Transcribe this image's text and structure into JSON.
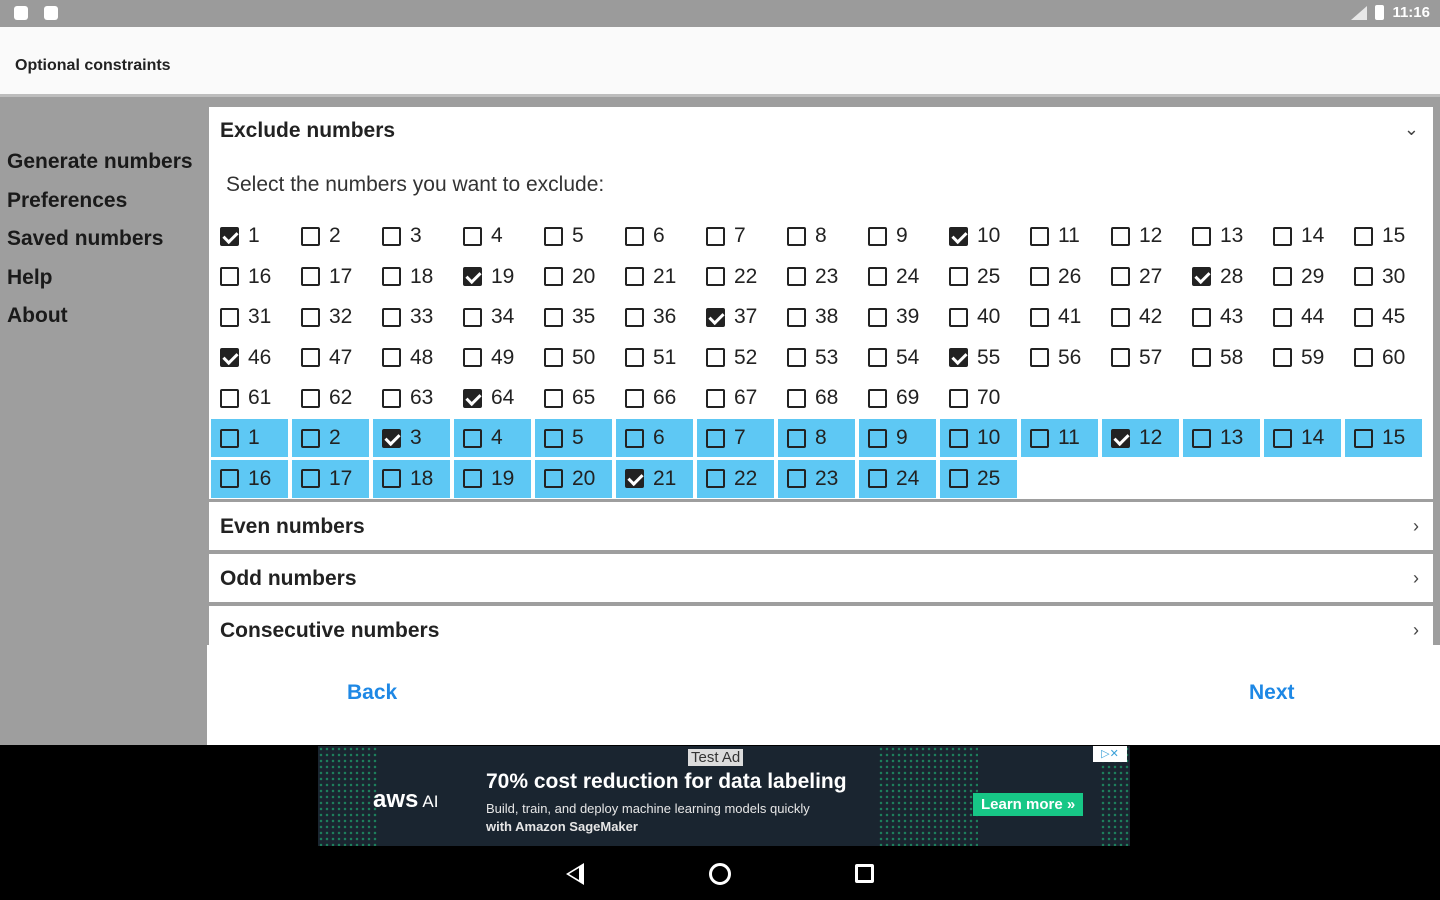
{
  "status_bar": {
    "time": "11:16"
  },
  "app_bar": {
    "title": "Optional constraints"
  },
  "sidebar": {
    "items": [
      {
        "label": "Generate numbers"
      },
      {
        "label": "Preferences"
      },
      {
        "label": "Saved numbers"
      },
      {
        "label": "Help"
      },
      {
        "label": "About"
      }
    ]
  },
  "exclude": {
    "title": "Exclude numbers",
    "description": "Select the numbers you want to exclude:",
    "main_numbers": [
      {
        "n": "1",
        "checked": true
      },
      {
        "n": "2",
        "checked": false
      },
      {
        "n": "3",
        "checked": false
      },
      {
        "n": "4",
        "checked": false
      },
      {
        "n": "5",
        "checked": false
      },
      {
        "n": "6",
        "checked": false
      },
      {
        "n": "7",
        "checked": false
      },
      {
        "n": "8",
        "checked": false
      },
      {
        "n": "9",
        "checked": false
      },
      {
        "n": "10",
        "checked": true
      },
      {
        "n": "11",
        "checked": false
      },
      {
        "n": "12",
        "checked": false
      },
      {
        "n": "13",
        "checked": false
      },
      {
        "n": "14",
        "checked": false
      },
      {
        "n": "15",
        "checked": false
      },
      {
        "n": "16",
        "checked": false
      },
      {
        "n": "17",
        "checked": false
      },
      {
        "n": "18",
        "checked": false
      },
      {
        "n": "19",
        "checked": true
      },
      {
        "n": "20",
        "checked": false
      },
      {
        "n": "21",
        "checked": false
      },
      {
        "n": "22",
        "checked": false
      },
      {
        "n": "23",
        "checked": false
      },
      {
        "n": "24",
        "checked": false
      },
      {
        "n": "25",
        "checked": false
      },
      {
        "n": "26",
        "checked": false
      },
      {
        "n": "27",
        "checked": false
      },
      {
        "n": "28",
        "checked": true
      },
      {
        "n": "29",
        "checked": false
      },
      {
        "n": "30",
        "checked": false
      },
      {
        "n": "31",
        "checked": false
      },
      {
        "n": "32",
        "checked": false
      },
      {
        "n": "33",
        "checked": false
      },
      {
        "n": "34",
        "checked": false
      },
      {
        "n": "35",
        "checked": false
      },
      {
        "n": "36",
        "checked": false
      },
      {
        "n": "37",
        "checked": true
      },
      {
        "n": "38",
        "checked": false
      },
      {
        "n": "39",
        "checked": false
      },
      {
        "n": "40",
        "checked": false
      },
      {
        "n": "41",
        "checked": false
      },
      {
        "n": "42",
        "checked": false
      },
      {
        "n": "43",
        "checked": false
      },
      {
        "n": "44",
        "checked": false
      },
      {
        "n": "45",
        "checked": false
      },
      {
        "n": "46",
        "checked": true
      },
      {
        "n": "47",
        "checked": false
      },
      {
        "n": "48",
        "checked": false
      },
      {
        "n": "49",
        "checked": false
      },
      {
        "n": "50",
        "checked": false
      },
      {
        "n": "51",
        "checked": false
      },
      {
        "n": "52",
        "checked": false
      },
      {
        "n": "53",
        "checked": false
      },
      {
        "n": "54",
        "checked": false
      },
      {
        "n": "55",
        "checked": true
      },
      {
        "n": "56",
        "checked": false
      },
      {
        "n": "57",
        "checked": false
      },
      {
        "n": "58",
        "checked": false
      },
      {
        "n": "59",
        "checked": false
      },
      {
        "n": "60",
        "checked": false
      },
      {
        "n": "61",
        "checked": false
      },
      {
        "n": "62",
        "checked": false
      },
      {
        "n": "63",
        "checked": false
      },
      {
        "n": "64",
        "checked": true
      },
      {
        "n": "65",
        "checked": false
      },
      {
        "n": "66",
        "checked": false
      },
      {
        "n": "67",
        "checked": false
      },
      {
        "n": "68",
        "checked": false
      },
      {
        "n": "69",
        "checked": false
      },
      {
        "n": "70",
        "checked": false
      }
    ],
    "bonus_numbers": [
      {
        "n": "1",
        "checked": false
      },
      {
        "n": "2",
        "checked": false
      },
      {
        "n": "3",
        "checked": true
      },
      {
        "n": "4",
        "checked": false
      },
      {
        "n": "5",
        "checked": false
      },
      {
        "n": "6",
        "checked": false
      },
      {
        "n": "7",
        "checked": false
      },
      {
        "n": "8",
        "checked": false
      },
      {
        "n": "9",
        "checked": false
      },
      {
        "n": "10",
        "checked": false
      },
      {
        "n": "11",
        "checked": false
      },
      {
        "n": "12",
        "checked": true
      },
      {
        "n": "13",
        "checked": false
      },
      {
        "n": "14",
        "checked": false
      },
      {
        "n": "15",
        "checked": false
      },
      {
        "n": "16",
        "checked": false
      },
      {
        "n": "17",
        "checked": false
      },
      {
        "n": "18",
        "checked": false
      },
      {
        "n": "19",
        "checked": false
      },
      {
        "n": "20",
        "checked": false
      },
      {
        "n": "21",
        "checked": true
      },
      {
        "n": "22",
        "checked": false
      },
      {
        "n": "23",
        "checked": false
      },
      {
        "n": "24",
        "checked": false
      },
      {
        "n": "25",
        "checked": false
      }
    ],
    "bonus_color": "#5ec8f4"
  },
  "sections": [
    {
      "title": "Even numbers"
    },
    {
      "title": "Odd numbers"
    },
    {
      "title": "Consecutive numbers"
    }
  ],
  "footer": {
    "back_label": "Back",
    "next_label": "Next",
    "link_color": "#1e88e5"
  },
  "ad": {
    "badge": "Test Ad",
    "brand": "aws",
    "brand_suffix": "AI",
    "headline": "70% cost reduction for data labeling",
    "subtext_line1": "Build, train, and deploy machine learning models quickly",
    "subtext_line2": "with Amazon SageMaker",
    "cta": "Learn more »",
    "choices_label": "▷✕"
  },
  "nav_bar": {
    "icons": [
      "back-icon",
      "home-icon",
      "recent-apps-icon"
    ]
  }
}
